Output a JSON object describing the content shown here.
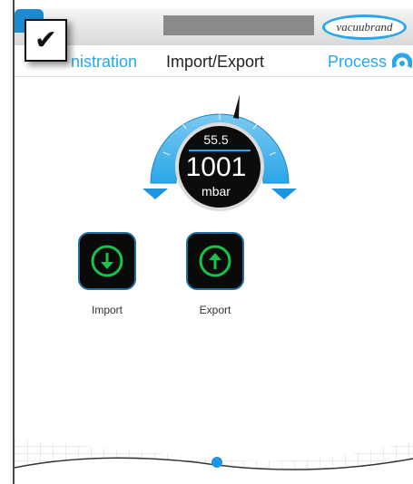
{
  "header": {
    "brand": "vacuubrand",
    "checkbox_mark": "✔"
  },
  "nav": {
    "left_label": "nistration",
    "center_title": "Import/Export",
    "right_label": "Process"
  },
  "gauge": {
    "setpoint": "55.5",
    "pressure": "1001",
    "unit": "mbar"
  },
  "actions": {
    "import_label": "Import",
    "export_label": "Export"
  },
  "colors": {
    "accent": "#2aa7e8",
    "button_icon": "#19c24a",
    "button_bg": "#0a0a0a"
  }
}
